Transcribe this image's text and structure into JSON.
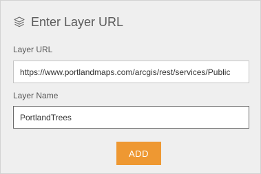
{
  "header": {
    "title": "Enter Layer URL",
    "icon": "layers-icon"
  },
  "layer_url": {
    "label": "Layer URL",
    "value": "https://www.portlandmaps.com/arcgis/rest/services/Public"
  },
  "layer_name": {
    "label": "Layer Name",
    "value": "PortlandTrees"
  },
  "actions": {
    "add_label": "ADD"
  },
  "colors": {
    "accent": "#ee9832",
    "panel_background": "#efefef"
  }
}
